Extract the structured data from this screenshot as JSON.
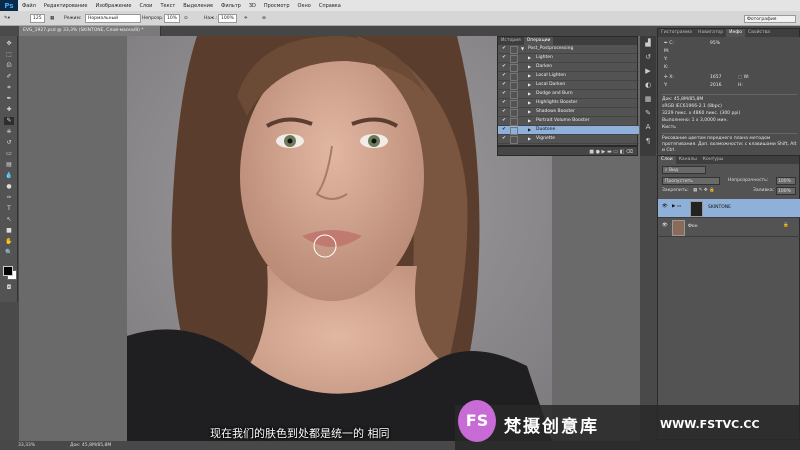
{
  "app": {
    "logo": "Ps"
  },
  "menu": [
    "Файл",
    "Редактирование",
    "Изображение",
    "Слои",
    "Текст",
    "Выделение",
    "Фильтр",
    "3D",
    "Просмотр",
    "Окно",
    "Справка"
  ],
  "workspace": "Фотография",
  "options": {
    "brush_size": "125",
    "mode_label": "Режим:",
    "mode_value": "Нормальный",
    "opacity_label": "Непрозр.:",
    "opacity_value": "10%",
    "flow_label": "Наж.:",
    "flow_value": "100%"
  },
  "document": {
    "tab_title": "EVG_1927.psd @ 33,3% (SKINTONE, Слой-маска/8) *",
    "zoom": "33,33%",
    "doc_size": "Док: 45,8M/85,8M"
  },
  "actions_panel": {
    "tabs": [
      "История",
      "Операции"
    ],
    "active_tab": "Операции",
    "set_name": "Post_Postprocessing",
    "items": [
      "Lighten",
      "Darken",
      "Local Lighten",
      "Local Darken",
      "Dodge and Burn",
      "Highlights Booster",
      "Shadows Booster",
      "Portrait Volume Booster",
      "Duotone",
      "Vignette"
    ],
    "selected_index": 8,
    "footer_icons": "■ ● ▶ ▬ ▭ ◧ ⌫"
  },
  "info_panel": {
    "tabs": [
      "Гистограмма",
      "Навигатор",
      "Инфо",
      "Свойства"
    ],
    "active_tab": "Инфо",
    "c": "95%",
    "m": "",
    "y": "",
    "k": "",
    "x": "1657",
    "y_coord": "2016",
    "w": "",
    "h": "",
    "doc_line": "Док: 45,8M/85,8M",
    "profile_line": "sRGB IEC61966-2.1 (8bpc)",
    "size_line": "3229 пикс. x 4860 пикс. (300 ppi)",
    "time_line": "Выполнено: 1 x 3,0000 мин.",
    "tool_line": "Кисть",
    "hint": "Рисование цветом переднего плана методом протягивания. Доп. возможности: с клавишами Shift, Alt и Ctrl."
  },
  "layers_panel": {
    "tabs": [
      "Слои",
      "Каналы",
      "Контуры"
    ],
    "active_tab": "Слои",
    "filter_label": "Вид",
    "blend_mode": "Пропустить",
    "opacity_label": "Непрозрачность:",
    "opacity_value": "100%",
    "lock_label": "Закрепить:",
    "fill_label": "Заливка:",
    "fill_value": "100%",
    "layers": [
      {
        "name": "SKINTONE",
        "selected": true
      },
      {
        "name": "Фон",
        "selected": false
      }
    ]
  },
  "subtitle": "现在我们的肤色到处都是统一的 相同",
  "watermark": {
    "logo": "FS",
    "name": "梵摄创意库",
    "url": "WWW.FSTVC.CC"
  }
}
